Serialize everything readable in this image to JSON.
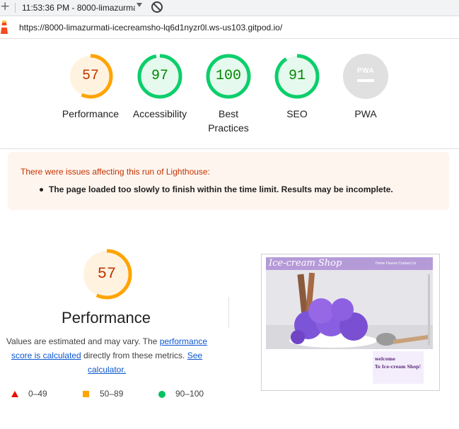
{
  "toolbar": {
    "time_title": "11:53:36 PM - 8000-limazurma"
  },
  "urlbar": {
    "url": "https://8000-limazurmati-icecreamsho-lq6d1nyzr0l.ws-us103.gitpod.io/"
  },
  "scores": [
    {
      "label": "Performance",
      "value": "57",
      "score": 57,
      "color": "#ffa400",
      "bg": "#fff3e0",
      "text_color": "#c33300"
    },
    {
      "label": "Accessibility",
      "value": "97",
      "score": 97,
      "color": "#0cce6b",
      "bg": "#e6f9ee",
      "text_color": "#008800"
    },
    {
      "label": "Best Practices",
      "value": "100",
      "score": 100,
      "color": "#0cce6b",
      "bg": "#e6f9ee",
      "text_color": "#008800"
    },
    {
      "label": "SEO",
      "value": "91",
      "score": 91,
      "color": "#0cce6b",
      "bg": "#e6f9ee",
      "text_color": "#008800"
    },
    {
      "label": "PWA",
      "value": "PWA",
      "score": null,
      "color": "#cccccc",
      "bg": "#e0e0e0",
      "text_color": "#ffffff"
    }
  ],
  "warning": {
    "title": "There were issues affecting this run of Lighthouse:",
    "item": "The page loaded too slowly to finish within the time limit. Results may be incomplete."
  },
  "performance": {
    "value": "57",
    "title": "Performance",
    "desc_prefix": "Values are estimated and may vary. The ",
    "link_score": "performance score is calculated",
    "desc_mid": " directly from these metrics. ",
    "link_calc": "See calculator."
  },
  "legend": {
    "fail": "0–49",
    "average": "50–89",
    "pass": "90–100"
  },
  "screenshot": {
    "logo": "Ice-cream Shop",
    "menu": "Home  Flavors  Contact Us",
    "welcome_line1": "welcome",
    "welcome_line2": "To Ice-cream Shop!"
  }
}
